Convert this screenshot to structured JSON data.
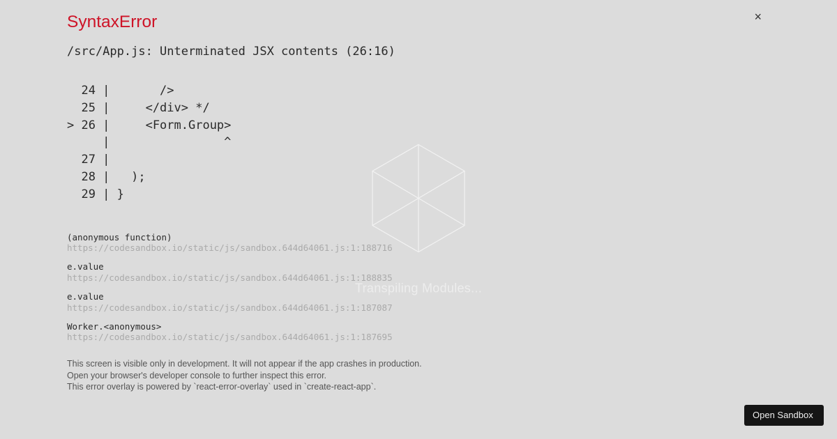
{
  "backdrop": {
    "status_text": "Transpiling Modules..."
  },
  "error": {
    "title": "SyntaxError",
    "message": "/src/App.js: Unterminated JSX contents (26:16)",
    "code": "  24 |       />\n  25 |     </div> */\n> 26 |     <Form.Group>\n     |                ^\n  27 | \n  28 |   );\n  29 | }"
  },
  "stack": [
    {
      "fn": "(anonymous function)",
      "loc": "https://codesandbox.io/static/js/sandbox.644d64061.js:1:188716"
    },
    {
      "fn": "e.value",
      "loc": "https://codesandbox.io/static/js/sandbox.644d64061.js:1:188835"
    },
    {
      "fn": "e.value",
      "loc": "https://codesandbox.io/static/js/sandbox.644d64061.js:1:187087"
    },
    {
      "fn": "Worker.<anonymous>",
      "loc": "https://codesandbox.io/static/js/sandbox.644d64061.js:1:187695"
    }
  ],
  "footer": {
    "line1": "This screen is visible only in development. It will not appear if the app crashes in production.",
    "line2": "Open your browser's developer console to further inspect this error.",
    "line3": "This error overlay is powered by `react-error-overlay` used in `create-react-app`."
  },
  "buttons": {
    "open_sandbox": "Open Sandbox",
    "close": "×"
  }
}
